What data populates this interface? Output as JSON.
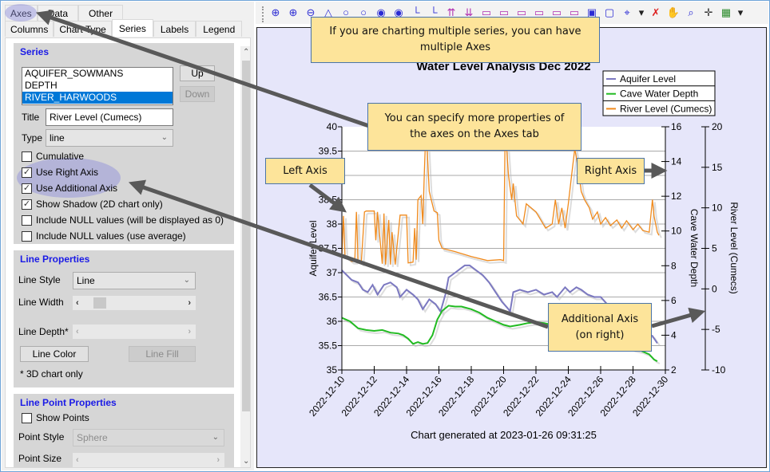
{
  "tabs_top": [
    {
      "label": "Axes",
      "active": false
    },
    {
      "label": "Data",
      "active": false
    },
    {
      "label": "Other",
      "active": false
    }
  ],
  "tabs_bottom": [
    {
      "label": "Columns",
      "active": false
    },
    {
      "label": "Chart Type",
      "active": false
    },
    {
      "label": "Series",
      "active": true
    },
    {
      "label": "Labels",
      "active": false
    },
    {
      "label": "Legend",
      "active": false
    }
  ],
  "series_group": {
    "title": "Series",
    "list": [
      "AQUIFER_SOWMANS",
      "DEPTH",
      "RIVER_HARWOODS"
    ],
    "selected_index": 2,
    "up_label": "Up",
    "down_label": "Down",
    "title_label": "Title",
    "title_value": "River Level (Cumecs)",
    "type_label": "Type",
    "type_value": "line",
    "checkboxes": [
      {
        "label": "Cumulative",
        "checked": false
      },
      {
        "label": "Use Right Axis",
        "checked": true
      },
      {
        "label": "Use Additional Axis",
        "checked": true
      },
      {
        "label": "Show Shadow (2D chart only)",
        "checked": true
      },
      {
        "label": "Include NULL values (will be displayed as 0)",
        "checked": false
      },
      {
        "label": "Include NULL values (use average)",
        "checked": false
      }
    ]
  },
  "line_group": {
    "title": "Line Properties",
    "style_label": "Line Style",
    "style_value": "Line",
    "width_label": "Line Width",
    "depth_label": "Line Depth*",
    "color_button": "Line Color",
    "fill_button": "Line Fill",
    "note": "* 3D chart only"
  },
  "point_group": {
    "title": "Line Point Properties",
    "show_points_label": "Show Points",
    "show_points_checked": false,
    "style_label": "Point Style",
    "style_value": "Sphere",
    "size_label": "Point Size"
  },
  "toolbar": {
    "tools": [
      "rotate-x-icon",
      "rotate-y-icon",
      "rotate-z-icon",
      "elevation-icon",
      "zoom-circle-icon",
      "zoom-circle-2-icon",
      "view-eye-icon",
      "view-eye-2-icon",
      "axis-icon",
      "axis-2-icon",
      "increase-height-icon",
      "decrease-height-icon",
      "add-depth-icon",
      "remove-depth-icon",
      "add-width-icon",
      "remove-width-icon",
      "add-x-icon",
      "remove-x-icon",
      "cube-3d-icon",
      "cube-2d-icon",
      "axes-3d-icon",
      "dropdown-icon",
      "reset-icon",
      "pan-hand-icon",
      "zoom-select-icon",
      "move-cursor-icon",
      "chart-image-icon",
      "dropdown-icon"
    ]
  },
  "callouts": {
    "multiple_axes": "If you are charting multiple series, you can have multiple Axes",
    "axes_tab": "You can specify more properties of the axes on the Axes tab",
    "left_axis": "Left Axis",
    "right_axis": "Right Axis",
    "additional_axis_line1": "Additional Axis",
    "additional_axis_line2": "(on right)"
  },
  "chart_data": {
    "type": "line",
    "title": "Water Level Analysis Dec 2022",
    "footer": "Chart generated at 2023-01-26 09:31:25",
    "x_tick_labels": [
      "2022-12-10",
      "2022-12-12",
      "2022-12-14",
      "2022-12-16",
      "2022-12-18",
      "2022-12-20",
      "2022-12-22",
      "2022-12-24",
      "2022-12-26",
      "2022-12-28",
      "2022-12-30"
    ],
    "x_range_days": [
      0,
      20
    ],
    "grid": true,
    "legend_position": "top-right",
    "axes": [
      {
        "id": "left",
        "label": "Aquifer Level",
        "range": [
          35,
          40
        ],
        "ticks": [
          "35",
          "35.5",
          "36",
          "36.5",
          "37",
          "37.5",
          "38",
          "38.5",
          "39",
          "39.5",
          "40"
        ]
      },
      {
        "id": "right",
        "label": "Cave Water Depth",
        "range": [
          2,
          16
        ],
        "ticks": [
          "2",
          "4",
          "6",
          "8",
          "10",
          "12",
          "14",
          "16"
        ]
      },
      {
        "id": "additional",
        "label": "River Level (Cumecs)",
        "range": [
          -10,
          20
        ],
        "ticks": [
          "-10",
          "-5",
          "0",
          "5",
          "10",
          "15",
          "20"
        ]
      }
    ],
    "series": [
      {
        "name": "Aquifer Level",
        "axis": "left",
        "color": "#7b78c0",
        "points": [
          [
            0,
            37.05
          ],
          [
            0.3,
            36.95
          ],
          [
            0.6,
            36.85
          ],
          [
            1,
            36.8
          ],
          [
            1.3,
            36.65
          ],
          [
            1.6,
            36.6
          ],
          [
            1.9,
            36.75
          ],
          [
            2.2,
            36.55
          ],
          [
            2.6,
            36.75
          ],
          [
            3,
            36.8
          ],
          [
            3.4,
            36.7
          ],
          [
            3.6,
            36.5
          ],
          [
            4,
            36.65
          ],
          [
            4.4,
            36.55
          ],
          [
            4.7,
            36.45
          ],
          [
            5,
            36.25
          ],
          [
            5.4,
            36.45
          ],
          [
            5.8,
            36.35
          ],
          [
            6.1,
            36.2
          ],
          [
            6.4,
            36.55
          ],
          [
            6.6,
            36.9
          ],
          [
            7,
            37.0
          ],
          [
            7.4,
            37.1
          ],
          [
            7.6,
            37.15
          ],
          [
            7.9,
            37.15
          ],
          [
            8.3,
            37.05
          ],
          [
            8.7,
            36.95
          ],
          [
            9.1,
            36.8
          ],
          [
            9.5,
            36.6
          ],
          [
            9.9,
            36.4
          ],
          [
            10.3,
            36.25
          ],
          [
            10.4,
            36.2
          ],
          [
            10.6,
            36.6
          ],
          [
            11,
            36.65
          ],
          [
            11.5,
            36.6
          ],
          [
            12,
            36.65
          ],
          [
            12.5,
            36.55
          ],
          [
            13,
            36.6
          ],
          [
            13.3,
            36.5
          ],
          [
            13.8,
            36.7
          ],
          [
            14.1,
            36.6
          ],
          [
            14.5,
            36.7
          ],
          [
            14.8,
            36.65
          ],
          [
            15.2,
            36.55
          ],
          [
            15.6,
            36.5
          ],
          [
            16,
            36.5
          ],
          [
            16.4,
            36.35
          ],
          [
            16.8,
            36.2
          ],
          [
            17.2,
            36.0
          ],
          [
            17.6,
            35.9
          ],
          [
            18,
            35.85
          ],
          [
            18.4,
            35.8
          ],
          [
            18.8,
            35.75
          ],
          [
            19.2,
            35.7
          ],
          [
            19.5,
            35.55
          ]
        ]
      },
      {
        "name": "Cave Water Depth",
        "axis": "right",
        "color": "#22bb22",
        "points": [
          [
            0,
            5.0
          ],
          [
            0.5,
            4.8
          ],
          [
            1,
            4.4
          ],
          [
            1.5,
            4.3
          ],
          [
            2,
            4.25
          ],
          [
            2.5,
            4.3
          ],
          [
            3,
            4.15
          ],
          [
            3.5,
            4.1
          ],
          [
            3.8,
            4.0
          ],
          [
            4.1,
            3.8
          ],
          [
            4.4,
            3.5
          ],
          [
            4.7,
            3.6
          ],
          [
            5,
            3.5
          ],
          [
            5.3,
            3.55
          ],
          [
            5.6,
            4.0
          ],
          [
            5.9,
            4.9
          ],
          [
            6.2,
            5.4
          ],
          [
            6.6,
            5.7
          ],
          [
            7,
            5.65
          ],
          [
            7.4,
            5.65
          ],
          [
            8,
            5.5
          ],
          [
            8.5,
            5.3
          ],
          [
            9,
            5.0
          ],
          [
            9.5,
            4.8
          ],
          [
            10,
            4.6
          ],
          [
            10.4,
            4.5
          ],
          [
            11,
            4.6
          ],
          [
            11.5,
            4.7
          ],
          [
            12,
            4.75
          ],
          [
            12.5,
            4.7
          ],
          [
            13,
            4.6
          ],
          [
            13.5,
            4.4
          ],
          [
            14,
            4.2
          ],
          [
            14.5,
            4.1
          ],
          [
            15,
            4.0
          ],
          [
            15.5,
            3.9
          ],
          [
            16,
            3.8
          ],
          [
            16.5,
            3.6
          ],
          [
            17,
            3.5
          ],
          [
            17.5,
            3.4
          ],
          [
            18,
            3.2
          ],
          [
            18.5,
            3.1
          ],
          [
            19,
            2.9
          ],
          [
            19.3,
            2.6
          ],
          [
            19.5,
            2.5
          ]
        ]
      },
      {
        "name": "River Level (Cumecs)",
        "axis": "additional",
        "color": "#f08a1c",
        "points": [
          [
            0,
            4
          ],
          [
            0.1,
            9
          ],
          [
            0.2,
            4
          ],
          [
            0.4,
            3.7
          ],
          [
            0.6,
            3.4
          ],
          [
            0.8,
            3.4
          ],
          [
            0.9,
            9.5
          ],
          [
            1.0,
            3.5
          ],
          [
            1.2,
            3.2
          ],
          [
            1.4,
            9.5
          ],
          [
            1.5,
            9.6
          ],
          [
            2,
            9.6
          ],
          [
            2.1,
            6
          ],
          [
            2.2,
            9.5
          ],
          [
            2.5,
            3.1
          ],
          [
            2.6,
            9.3
          ],
          [
            2.7,
            3
          ],
          [
            2.9,
            8.5
          ],
          [
            3.0,
            3
          ],
          [
            3.1,
            7
          ],
          [
            3.3,
            3
          ],
          [
            3.6,
            9.1
          ],
          [
            4,
            9.1
          ],
          [
            4.1,
            3.2
          ],
          [
            4.4,
            3.3
          ],
          [
            4.5,
            7.5
          ],
          [
            4.6,
            3.6
          ],
          [
            4.7,
            11
          ],
          [
            4.9,
            11.5
          ],
          [
            5.0,
            8
          ],
          [
            5.1,
            14.5
          ],
          [
            5.2,
            20
          ],
          [
            5.4,
            12
          ],
          [
            5.7,
            9.6
          ],
          [
            5.9,
            9.4
          ],
          [
            6.0,
            6
          ],
          [
            6.2,
            5
          ],
          [
            7,
            4.6
          ],
          [
            8,
            4
          ],
          [
            9,
            3.5
          ],
          [
            9.8,
            3.6
          ],
          [
            10.0,
            3.5
          ],
          [
            10.1,
            20
          ],
          [
            10.3,
            14
          ],
          [
            10.5,
            11
          ],
          [
            10.6,
            13
          ],
          [
            10.8,
            9
          ],
          [
            11,
            8.5
          ],
          [
            11.2,
            8
          ],
          [
            11.4,
            10.5
          ],
          [
            12,
            9.5
          ],
          [
            12.6,
            7.5
          ],
          [
            13,
            8
          ],
          [
            13.2,
            11
          ],
          [
            13.4,
            8
          ],
          [
            13.6,
            10
          ],
          [
            13.8,
            7.5
          ],
          [
            14.0,
            10.5
          ],
          [
            14.2,
            14
          ],
          [
            14.4,
            17.3
          ],
          [
            14.6,
            15
          ],
          [
            14.8,
            12
          ],
          [
            15,
            11
          ],
          [
            15.3,
            10
          ],
          [
            15.5,
            8.6
          ],
          [
            15.8,
            9.5
          ],
          [
            16,
            8
          ],
          [
            16.3,
            8.8
          ],
          [
            16.6,
            7.8
          ],
          [
            17,
            8.5
          ],
          [
            17.3,
            7.5
          ],
          [
            17.6,
            8.4
          ],
          [
            18,
            7.3
          ],
          [
            18.3,
            8
          ],
          [
            18.6,
            7.2
          ],
          [
            19,
            7.0
          ],
          [
            19.2,
            11
          ],
          [
            19.3,
            9
          ],
          [
            19.5,
            7
          ],
          [
            19.6,
            6.6
          ]
        ]
      }
    ]
  }
}
